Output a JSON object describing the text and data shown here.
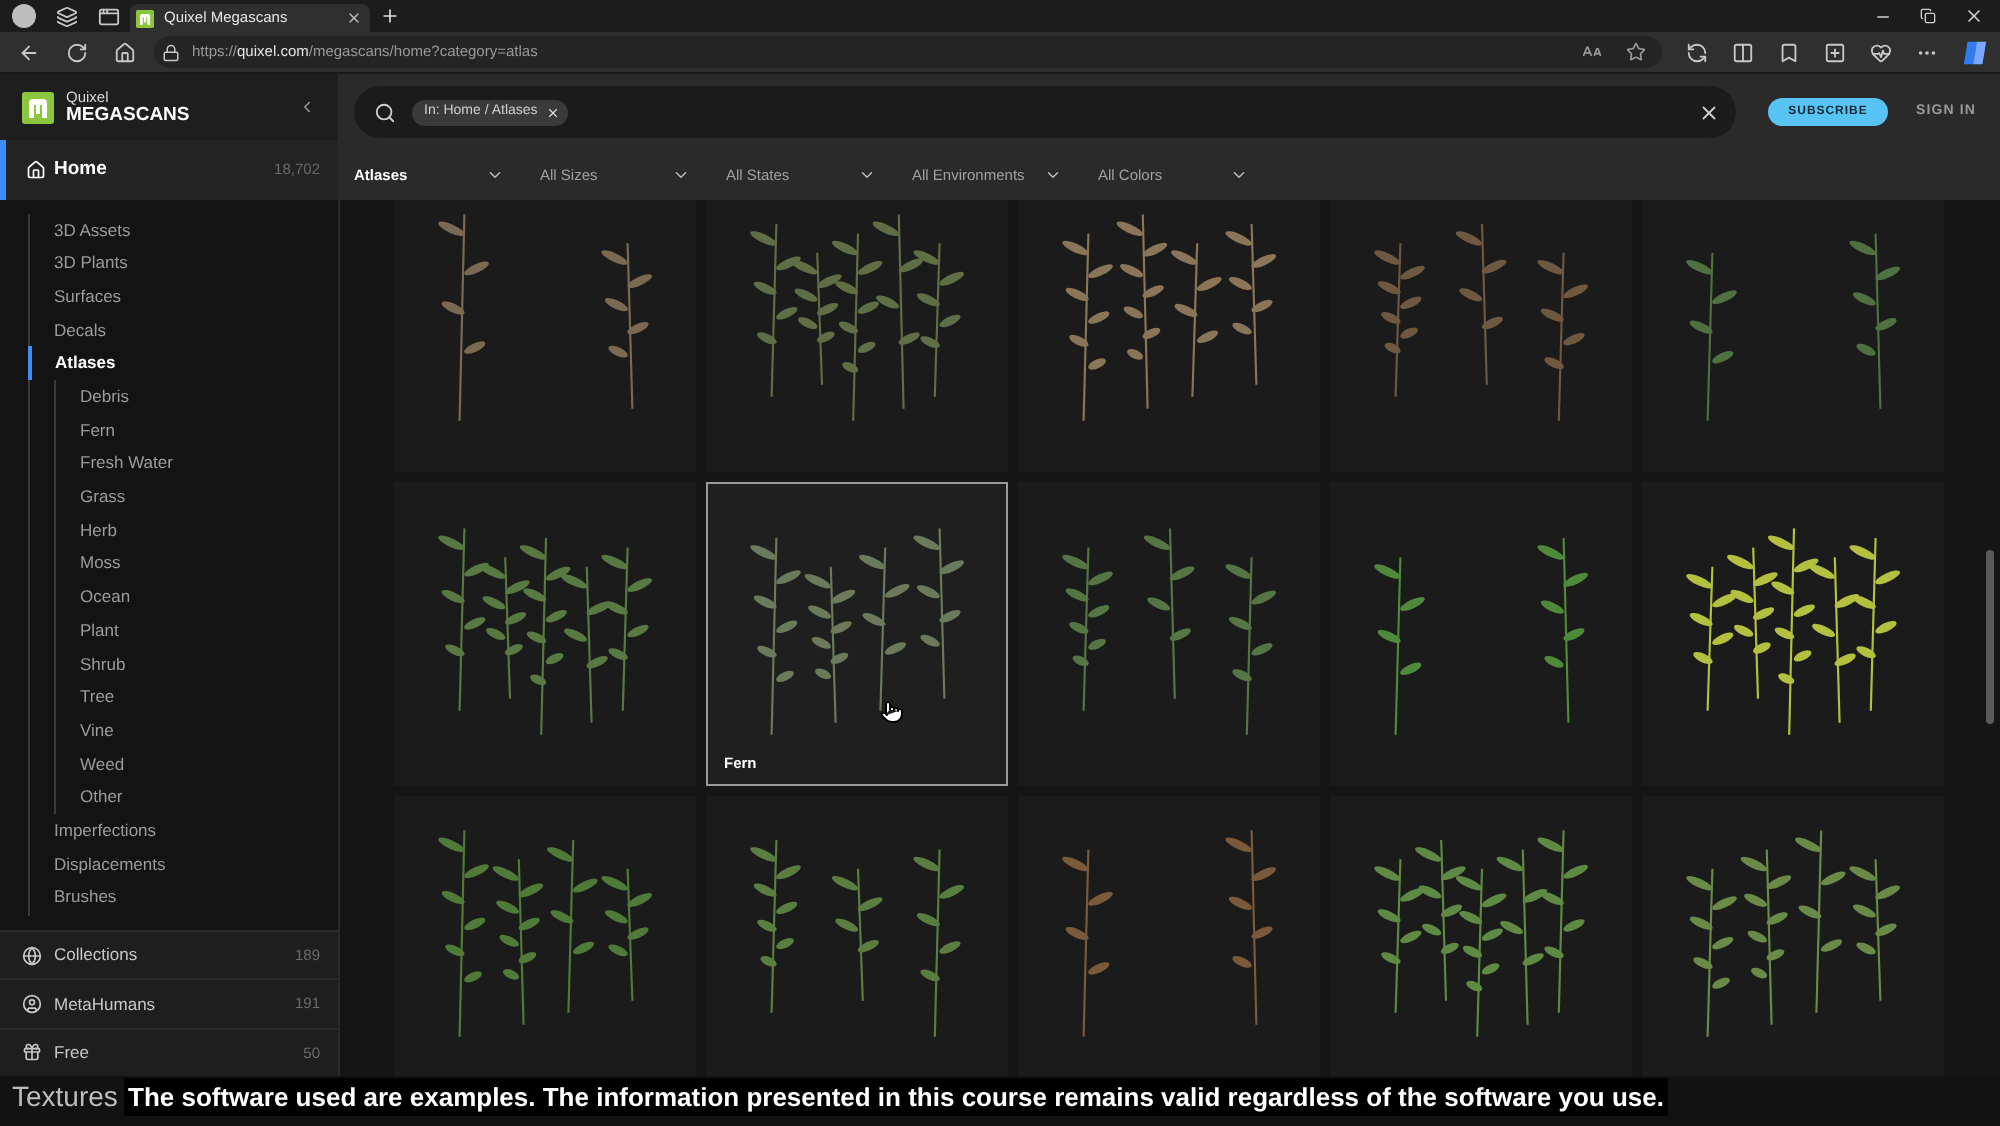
{
  "browser": {
    "tabs": [
      {
        "title": "Quixel Megascans",
        "selected": true
      }
    ],
    "address": {
      "scheme": "https://",
      "host": "quixel.com",
      "path": "/megascans/home?category=atlas"
    }
  },
  "sidebar": {
    "brand": {
      "top": "Quixel",
      "bottom": "MEGASCANS"
    },
    "home": {
      "label": "Home",
      "count": "18,702",
      "selected": true
    },
    "categories": [
      {
        "label": "3D Assets",
        "selected": false
      },
      {
        "label": "3D Plants",
        "selected": false
      },
      {
        "label": "Surfaces",
        "selected": false
      },
      {
        "label": "Decals",
        "selected": false
      },
      {
        "label": "Atlases",
        "selected": true,
        "children": [
          {
            "label": "Debris",
            "selected": false
          },
          {
            "label": "Fern",
            "selected": false
          },
          {
            "label": "Fresh Water",
            "selected": false
          },
          {
            "label": "Grass",
            "selected": false
          },
          {
            "label": "Herb",
            "selected": false
          },
          {
            "label": "Moss",
            "selected": false
          },
          {
            "label": "Ocean",
            "selected": false
          },
          {
            "label": "Plant",
            "selected": false
          },
          {
            "label": "Shrub",
            "selected": false
          },
          {
            "label": "Tree",
            "selected": false
          },
          {
            "label": "Vine",
            "selected": false
          },
          {
            "label": "Weed",
            "selected": false
          },
          {
            "label": "Other",
            "selected": false
          }
        ]
      },
      {
        "label": "Imperfections",
        "selected": false
      },
      {
        "label": "Displacements",
        "selected": false
      },
      {
        "label": "Brushes",
        "selected": false
      }
    ],
    "sections": [
      {
        "label": "Collections",
        "count": "189",
        "selected": false
      },
      {
        "label": "MetaHumans",
        "count": "191",
        "selected": false
      },
      {
        "label": "Free",
        "count": "50",
        "selected": false
      }
    ]
  },
  "search": {
    "chip": "In: Home / Atlases"
  },
  "account": {
    "subscribe": "SUBSCRIBE",
    "sign_in": "SIGN IN"
  },
  "filters": [
    {
      "label": "Atlases",
      "active": true
    },
    {
      "label": "All Sizes",
      "active": false
    },
    {
      "label": "All States",
      "active": false
    },
    {
      "label": "All Environments",
      "active": false
    },
    {
      "label": "All Colors",
      "active": false
    }
  ],
  "grid": {
    "tiles": [
      {
        "highlighted": false
      },
      {
        "highlighted": false
      },
      {
        "highlighted": false
      },
      {
        "highlighted": false
      },
      {
        "highlighted": false
      },
      {
        "highlighted": false
      },
      {
        "highlighted": true,
        "label": "Fern"
      },
      {
        "highlighted": false
      },
      {
        "highlighted": false
      },
      {
        "highlighted": false
      },
      {
        "highlighted": false
      },
      {
        "highlighted": false
      },
      {
        "highlighted": false
      },
      {
        "highlighted": false
      },
      {
        "highlighted": false
      }
    ]
  },
  "overlay": {
    "title": "Textures",
    "caption": "The software used are examples. The information presented in this course remains valid regardless of the software you use."
  }
}
